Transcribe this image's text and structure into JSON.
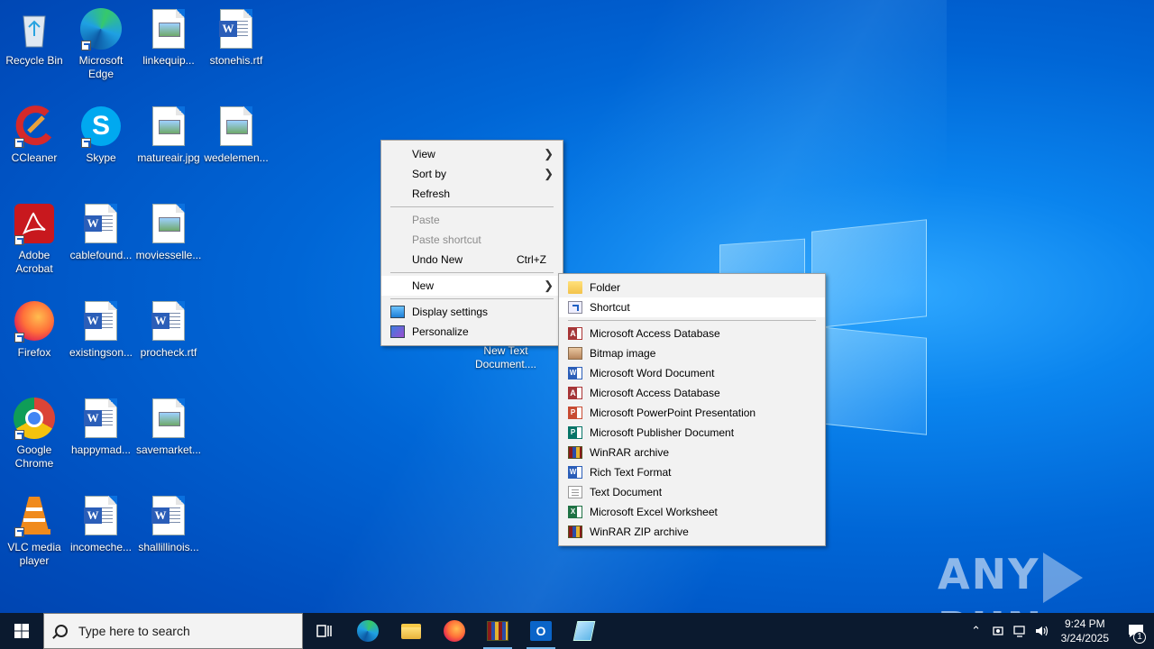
{
  "desktop": {
    "icons": [
      {
        "label": "Recycle Bin"
      },
      {
        "label": "Microsoft Edge"
      },
      {
        "label": "linkequip..."
      },
      {
        "label": "stonehis.rtf"
      },
      {
        "label": "CCleaner"
      },
      {
        "label": "Skype"
      },
      {
        "label": "matureair.jpg"
      },
      {
        "label": "wedelemen..."
      },
      {
        "label": "Adobe Acrobat"
      },
      {
        "label": "cablefound..."
      },
      {
        "label": "moviesselle..."
      },
      {
        "label": "Firefox"
      },
      {
        "label": "existingson..."
      },
      {
        "label": "procheck.rtf"
      },
      {
        "label": "Google Chrome"
      },
      {
        "label": "happymad..."
      },
      {
        "label": "savemarket..."
      },
      {
        "label": "VLC media player"
      },
      {
        "label": "incomeche..."
      },
      {
        "label": "shallillinois..."
      }
    ],
    "new_item_label": "New Text Document...."
  },
  "context_menu": {
    "view": "View",
    "sort_by": "Sort by",
    "refresh": "Refresh",
    "paste": "Paste",
    "paste_shortcut": "Paste shortcut",
    "undo_new": "Undo New",
    "undo_accel": "Ctrl+Z",
    "new": "New",
    "display_settings": "Display settings",
    "personalize": "Personalize"
  },
  "new_submenu": {
    "items": [
      {
        "label": "Folder",
        "icon": "folder-icon"
      },
      {
        "label": "Shortcut",
        "icon": "shortcut-icon"
      },
      {
        "label": "Microsoft Access Database",
        "icon": "access-icon"
      },
      {
        "label": "Bitmap image",
        "icon": "bitmap-icon"
      },
      {
        "label": "Microsoft Word Document",
        "icon": "word-icon"
      },
      {
        "label": "Microsoft Access Database",
        "icon": "access-icon"
      },
      {
        "label": "Microsoft PowerPoint Presentation",
        "icon": "powerpoint-icon"
      },
      {
        "label": "Microsoft Publisher Document",
        "icon": "publisher-icon"
      },
      {
        "label": "WinRAR archive",
        "icon": "winrar-icon"
      },
      {
        "label": "Rich Text Format",
        "icon": "rtf-icon"
      },
      {
        "label": "Text Document",
        "icon": "text-icon"
      },
      {
        "label": "Microsoft Excel Worksheet",
        "icon": "excel-icon"
      },
      {
        "label": "WinRAR ZIP archive",
        "icon": "winrar-zip-icon"
      }
    ]
  },
  "taskbar": {
    "search_placeholder": "Type here to search",
    "time": "9:24 PM",
    "date": "3/24/2025",
    "notification_count": "1"
  },
  "watermark": {
    "left": "ANY",
    "right": "RUN"
  }
}
